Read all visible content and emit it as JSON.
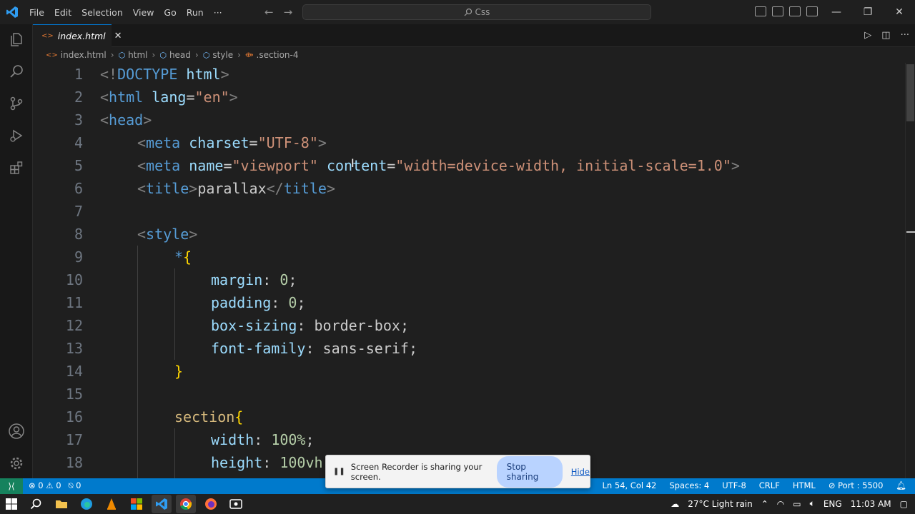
{
  "titlebar": {
    "menu": [
      "File",
      "Edit",
      "Selection",
      "View",
      "Go",
      "Run",
      "···"
    ],
    "search_text": "Css"
  },
  "tab": {
    "label": "index.html"
  },
  "breadcrumb": [
    "index.html",
    "html",
    "head",
    "style",
    ".section-4"
  ],
  "editor": {
    "line_numbers": [
      "1",
      "2",
      "3",
      "4",
      "5",
      "6",
      "7",
      "8",
      "9",
      "10",
      "11",
      "12",
      "13",
      "14",
      "15",
      "16",
      "17",
      "18"
    ],
    "lines": {
      "l1": [
        "<!",
        "DOCTYPE",
        " html",
        ">"
      ],
      "l2": [
        "<",
        "html",
        " lang",
        "=",
        "\"en\"",
        ">"
      ],
      "l3": [
        "<",
        "head",
        ">"
      ],
      "l4": [
        "<",
        "meta",
        " charset",
        "=",
        "\"UTF-8\"",
        ">"
      ],
      "l5": [
        "<",
        "meta",
        " name",
        "=",
        "\"viewport\"",
        " content",
        "=",
        "\"width=device-width, initial-scale=1.0\"",
        ">"
      ],
      "l6": [
        "<",
        "title",
        ">",
        "parallax",
        "</",
        "title",
        ">"
      ],
      "l8": [
        "<",
        "style",
        ">"
      ],
      "l9": [
        "*",
        "{"
      ],
      "l10": [
        "margin",
        ": ",
        "0",
        ";"
      ],
      "l11": [
        "padding",
        ": ",
        "0",
        ";"
      ],
      "l12": [
        "box-sizing",
        ": ",
        "border-box",
        ";"
      ],
      "l13": [
        "font-family",
        ": ",
        "sans-serif",
        ";"
      ],
      "l14": [
        "}"
      ],
      "l16": [
        "section",
        "{"
      ],
      "l17": [
        "width",
        ": ",
        "100%",
        ";"
      ],
      "l18": [
        "height",
        ": ",
        "100vh"
      ]
    }
  },
  "recorder": {
    "message": "Screen Recorder is sharing your screen.",
    "stop_label": "Stop sharing",
    "hide_label": "Hide"
  },
  "statusbar": {
    "errors": "0",
    "warnings": "0",
    "ports": "0",
    "position": "Ln 54, Col 42",
    "spaces": "Spaces: 4",
    "encoding": "UTF-8",
    "eol": "CRLF",
    "language": "HTML",
    "port": "Port : 5500"
  },
  "taskbar": {
    "weather": "27°C  Light rain",
    "lang": "ENG",
    "time": "11:03 AM"
  },
  "colors": {
    "accent": "#007acc",
    "remote": "#16825d",
    "tag": "#569cd6",
    "attr": "#9cdcfe",
    "string": "#ce9178",
    "selector": "#d7ba7d",
    "number": "#b5cea8"
  }
}
